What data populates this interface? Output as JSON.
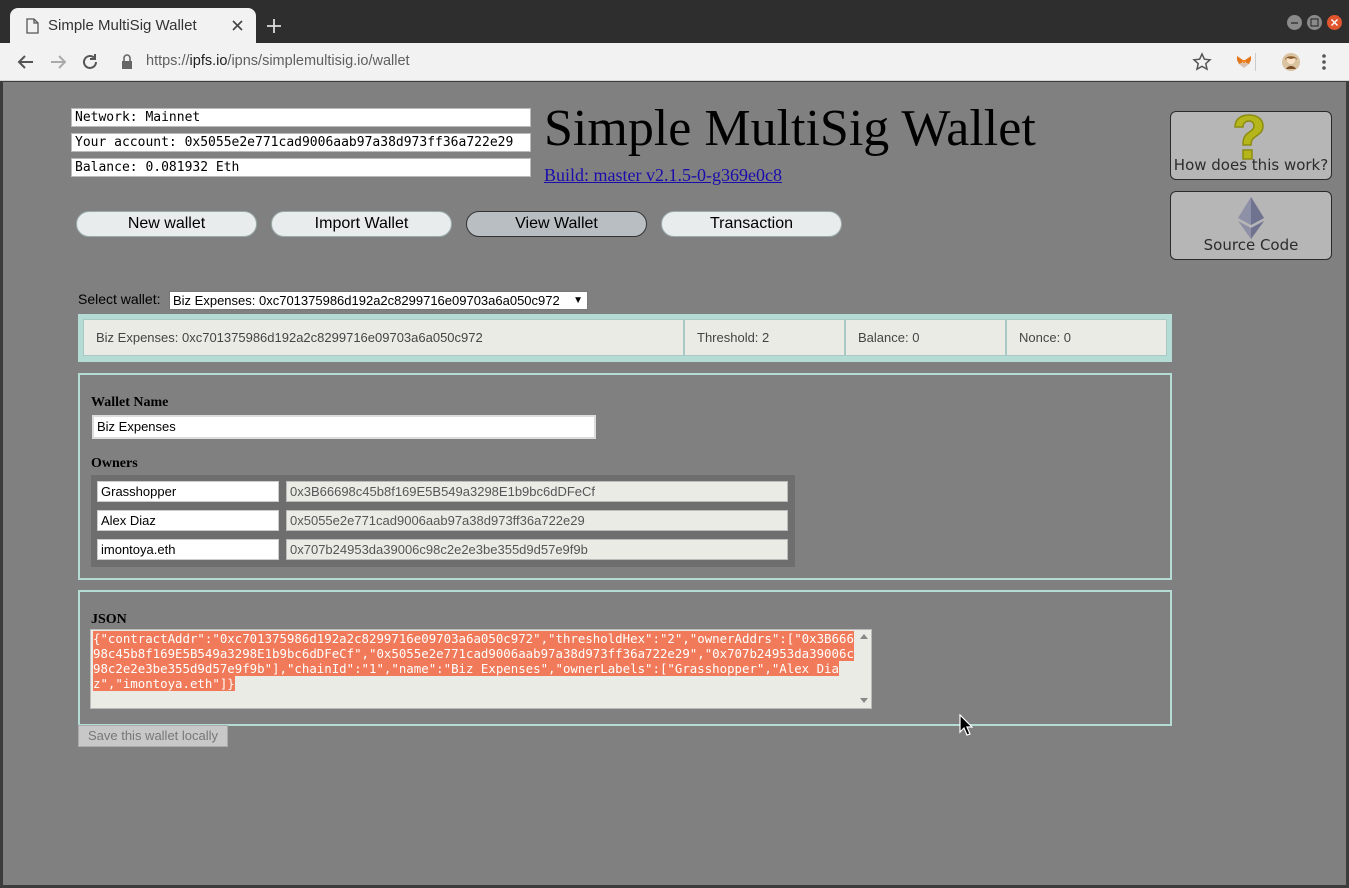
{
  "browser": {
    "tab_title": "Simple MultiSig Wallet",
    "url_scheme": "https://",
    "url_host": "ipfs.io",
    "url_path": "/ipns/simplemultisig.io/wallet"
  },
  "header": {
    "network": "Network: Mainnet",
    "account": "Your account: 0x5055e2e771cad9006aab97a38d973ff36a722e29",
    "balance": "Balance: 0.081932 Eth",
    "title": "Simple MultiSig Wallet",
    "build": "Build: master v2.1.5-0-g369e0c8"
  },
  "side": {
    "help_label": "How does this work?",
    "source_label": "Source Code"
  },
  "nav": {
    "items": [
      "New wallet",
      "Import Wallet",
      "View Wallet",
      "Transaction"
    ],
    "active": "View Wallet"
  },
  "selector": {
    "label": "Select wallet:",
    "value": "Biz Expenses: 0xc701375986d192a2c8299716e09703a6a050c972"
  },
  "summary": {
    "wallet": "Biz Expenses: 0xc701375986d192a2c8299716e09703a6a050c972",
    "threshold": "Threshold: 2",
    "balance": "Balance: 0",
    "nonce": "Nonce: 0"
  },
  "wallet": {
    "name_label": "Wallet Name",
    "name_value": "Biz Expenses",
    "owners_label": "Owners",
    "owners": [
      {
        "name": "Grasshopper",
        "address": "0x3B66698c45b8f169E5B549a3298E1b9bc6dDFeCf"
      },
      {
        "name": "Alex Diaz",
        "address": "0x5055e2e771cad9006aab97a38d973ff36a722e29"
      },
      {
        "name": "imontoya.eth",
        "address": "0x707b24953da39006c98c2e2e3be355d9d57e9f9b"
      }
    ]
  },
  "json": {
    "label": "JSON",
    "text": "{\"contractAddr\":\"0xc701375986d192a2c8299716e09703a6a050c972\",\"thresholdHex\":\"2\",\"ownerAddrs\":[\"0x3B66698c45b8f169E5B549a3298E1b9bc6dDFeCf\",\"0x5055e2e771cad9006aab97a38d973ff36a722e29\",\"0x707b24953da39006c98c2e2e3be355d9d57e9f9b\"],\"chainId\":\"1\",\"name\":\"Biz Expenses\",\"ownerLabels\":[\"Grasshopper\",\"Alex Diaz\",\"imontoya.eth\"]}"
  },
  "save_label": "Save this wallet locally",
  "colors": {
    "page_bg": "#808080",
    "accent_border": "#b5dbd5",
    "selection": "#f07a59",
    "link": "#1a0dab"
  }
}
